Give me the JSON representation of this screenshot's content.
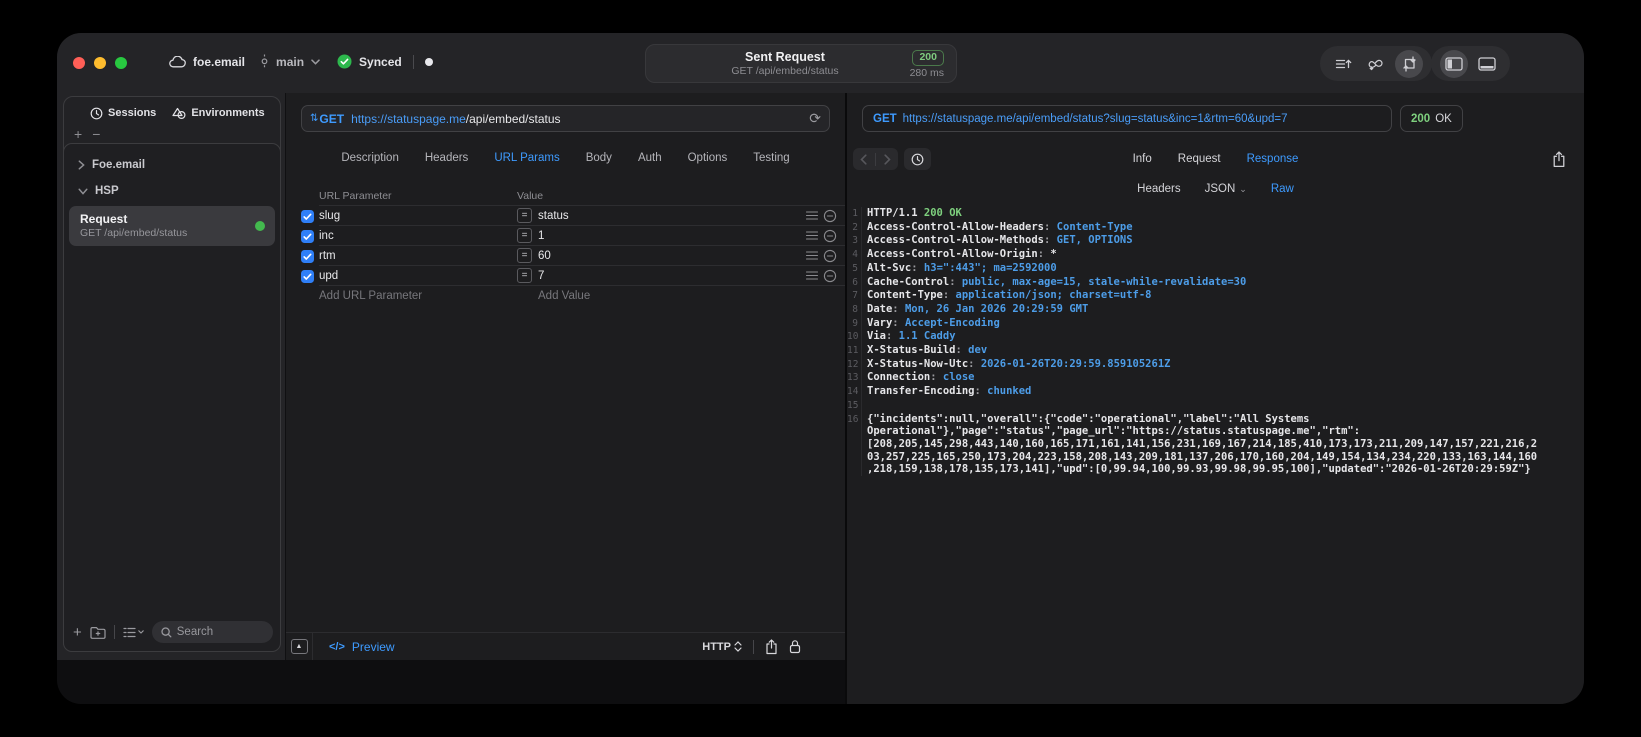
{
  "colors": {
    "accent_blue": "#3e9bff",
    "url_blue": "#4a9df8",
    "header_value_blue": "#4d9de8",
    "status_green": "#7ed07e",
    "checkbox_blue": "#2f7ff7",
    "active_dot_green": "#43b94e",
    "traffic_red": "#ff5f57",
    "traffic_yellow": "#febc2e",
    "traffic_green": "#28c840"
  },
  "titlebar": {
    "project": "foe.email",
    "branch": "main",
    "sync_label": "Synced",
    "center": {
      "title": "Sent Request",
      "subtitle": "GET /api/embed/status",
      "status_code": "200",
      "duration": "280 ms"
    }
  },
  "sidebar": {
    "tabs": [
      {
        "label": "Sessions"
      },
      {
        "label": "Environments"
      }
    ],
    "groups": [
      {
        "label": "Foe.email",
        "expanded": false
      },
      {
        "label": "HSP",
        "expanded": true
      }
    ],
    "request_item": {
      "title": "Request",
      "subtitle": "GET /api/embed/status"
    },
    "search_placeholder": "Search"
  },
  "request_panel": {
    "method": "GET",
    "url_host": "https://statuspage.me",
    "url_path": "/api/embed/status",
    "tabs": [
      {
        "label": "Description"
      },
      {
        "label": "Headers"
      },
      {
        "label": "URL Params",
        "active": true
      },
      {
        "label": "Body"
      },
      {
        "label": "Auth"
      },
      {
        "label": "Options"
      },
      {
        "label": "Testing"
      }
    ],
    "table": {
      "columns": [
        "URL Parameter",
        "Value"
      ],
      "rows": [
        {
          "name": "slug",
          "value": "status",
          "enabled": true
        },
        {
          "name": "inc",
          "value": "1",
          "enabled": true
        },
        {
          "name": "rtm",
          "value": "60",
          "enabled": true
        },
        {
          "name": "upd",
          "value": "7",
          "enabled": true
        }
      ],
      "add_param_placeholder": "Add URL Parameter",
      "add_value_placeholder": "Add Value"
    },
    "footer": {
      "preview_label": "Preview",
      "protocol": "HTTP"
    }
  },
  "response_panel": {
    "method": "GET",
    "url": "https://statuspage.me/api/embed/status?slug=status&inc=1&rtm=60&upd=7",
    "status_code": "200",
    "status_text": "OK",
    "tabs": [
      {
        "label": "Info"
      },
      {
        "label": "Request"
      },
      {
        "label": "Response",
        "active": true
      }
    ],
    "subtabs": [
      {
        "label": "Headers"
      },
      {
        "label": "JSON",
        "chevron": true
      },
      {
        "label": "Raw",
        "active": true
      }
    ],
    "status_line": {
      "http": "HTTP/1.1",
      "status": "200 OK"
    },
    "headers": [
      {
        "name": "Access-Control-Allow-Headers",
        "value": "Content-Type"
      },
      {
        "name": "Access-Control-Allow-Methods",
        "value": "GET, OPTIONS"
      },
      {
        "name": "Access-Control-Allow-Origin",
        "value": "*",
        "plain": true
      },
      {
        "name": "Alt-Svc",
        "value": "h3=\":443\"; ma=2592000"
      },
      {
        "name": "Cache-Control",
        "value": "public, max-age=15, stale-while-revalidate=30"
      },
      {
        "name": "Content-Type",
        "value": "application/json; charset=utf-8"
      },
      {
        "name": "Date",
        "value": "Mon, 26 Jan 2026 20:29:59 GMT"
      },
      {
        "name": "Vary",
        "value": "Accept-Encoding"
      },
      {
        "name": "Via",
        "value": "1.1 Caddy"
      },
      {
        "name": "X-Status-Build",
        "value": "dev"
      },
      {
        "name": "X-Status-Now-Utc",
        "value": "2026-01-26T20:29:59.859105261Z"
      },
      {
        "name": "Connection",
        "value": "close"
      },
      {
        "name": "Transfer-Encoding",
        "value": "chunked"
      }
    ],
    "body": "{\"incidents\":null,\"overall\":{\"code\":\"operational\",\"label\":\"All Systems Operational\"},\"page\":\"status\",\"page_url\":\"https://status.statuspage.me\",\"rtm\":[208,205,145,298,443,140,160,165,171,161,141,156,231,169,167,214,185,410,173,173,211,209,147,157,221,216,203,257,225,165,250,173,204,223,158,208,143,209,181,137,206,170,160,204,149,154,134,234,220,133,163,144,160,218,159,138,178,135,173,141],\"upd\":[0,99.94,100,99.93,99.98,99.95,100],\"updated\":\"2026-01-26T20:29:59Z\"}"
  }
}
